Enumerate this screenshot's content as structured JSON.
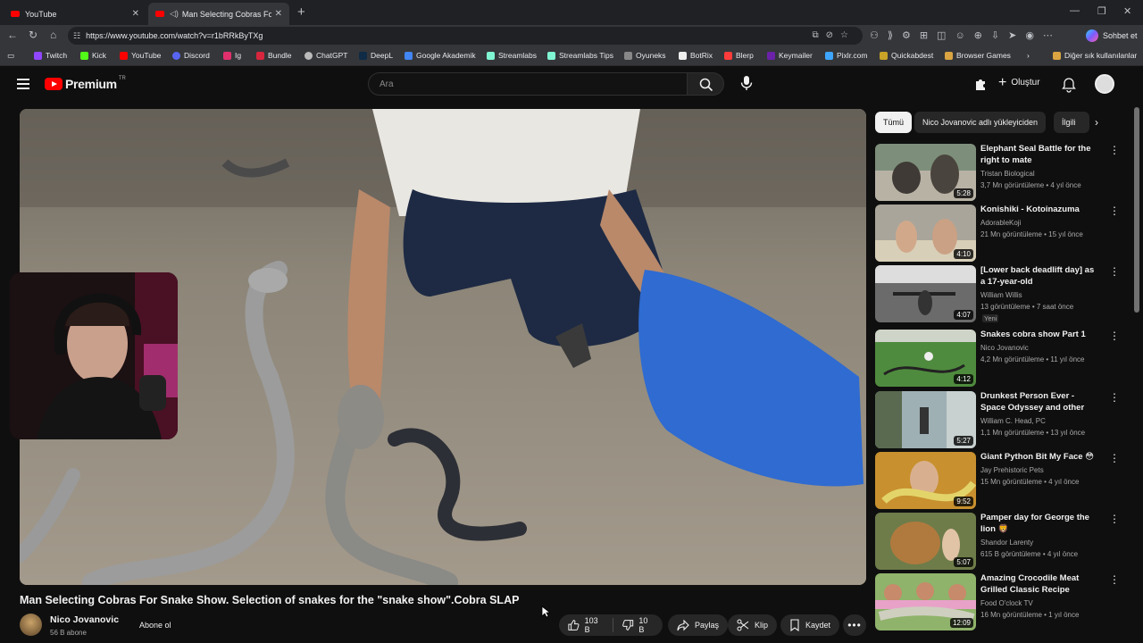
{
  "browser": {
    "tabs": [
      {
        "title": "YouTube"
      },
      {
        "title": "Man Selecting Cobras For Sna"
      }
    ],
    "url": "https://www.youtube.com/watch?v=r1bRRkByTXg",
    "chat_label": "Sohbet et",
    "bookmarks": [
      "Twitch",
      "Kick",
      "YouTube",
      "Discord",
      "Ig",
      "Bundle",
      "ChatGPT",
      "DeepL",
      "Google Akademik",
      "Streamlabs",
      "Streamlabs Tips",
      "Oyuneks",
      "BotRix",
      "Blerp",
      "Keymailer",
      "Pixlr.com",
      "Quickabdest",
      "Browser Games"
    ],
    "other_bookmarks": "Diğer sık kullanılanlar"
  },
  "youtube": {
    "logo_word": "Premium",
    "logo_region": "TR",
    "search_placeholder": "Ara",
    "create_label": "Oluştur"
  },
  "video": {
    "title": "Man Selecting Cobras For Snake Show. Selection of snakes for the \"snake show\".Cobra SLAP",
    "channel": "Nico Jovanovic",
    "subscribers": "56 B abone",
    "subscribe_label": "Abone ol",
    "likes": "103 B",
    "dislikes": "10 B",
    "share_label": "Paylaş",
    "clip_label": "Klip",
    "save_label": "Kaydet"
  },
  "sidebar": {
    "chips": [
      "Tümü",
      "Nico Jovanovic adlı yükleyiciden",
      "İlgili"
    ],
    "recommendations": [
      {
        "title": "Elephant Seal Battle for the right to mate",
        "channel": "Tristan Biological",
        "meta": "3,7 Mn görüntüleme • 4 yıl önce",
        "duration": "5:28"
      },
      {
        "title": "Konishiki - Kotoinazuma",
        "channel": "AdorableKoji",
        "meta": "21 Mn görüntüleme • 15 yıl önce",
        "duration": "4:10"
      },
      {
        "title": "[Lower back deadlift day] as a 17-year-old",
        "channel": "William Willis",
        "meta": "13 görüntüleme • 7 saat önce",
        "badge": "Yeni",
        "duration": "4:07"
      },
      {
        "title": "Snakes cobra show  Part 1",
        "channel": "Nico Jovanovic",
        "meta": "4,2 Mn görüntüleme • 11 yıl önce",
        "duration": "4:12"
      },
      {
        "title": "Drunkest Person Ever - Space Odyssey and other Classical ...",
        "channel": "William C. Head, PC",
        "meta": "1,1 Mn görüntüleme • 13 yıl önce",
        "duration": "5:27"
      },
      {
        "title": "Giant Python Bit My Face 😳",
        "channel": "Jay Prehistoric Pets",
        "meta": "15 Mn görüntüleme • 4 yıl önce",
        "duration": "9:52"
      },
      {
        "title": "Pamper day for George the lion 🦁",
        "channel": "Shandor Larenty",
        "meta": "615 B görüntüleme • 4 yıl önce",
        "duration": "5:07"
      },
      {
        "title": "Amazing Crocodile Meat Grilled Classic Recipe Ingredients ...",
        "channel": "Food O'clock TV",
        "meta": "16 Mn görüntüleme • 1 yıl önce",
        "duration": "12:09"
      }
    ]
  }
}
